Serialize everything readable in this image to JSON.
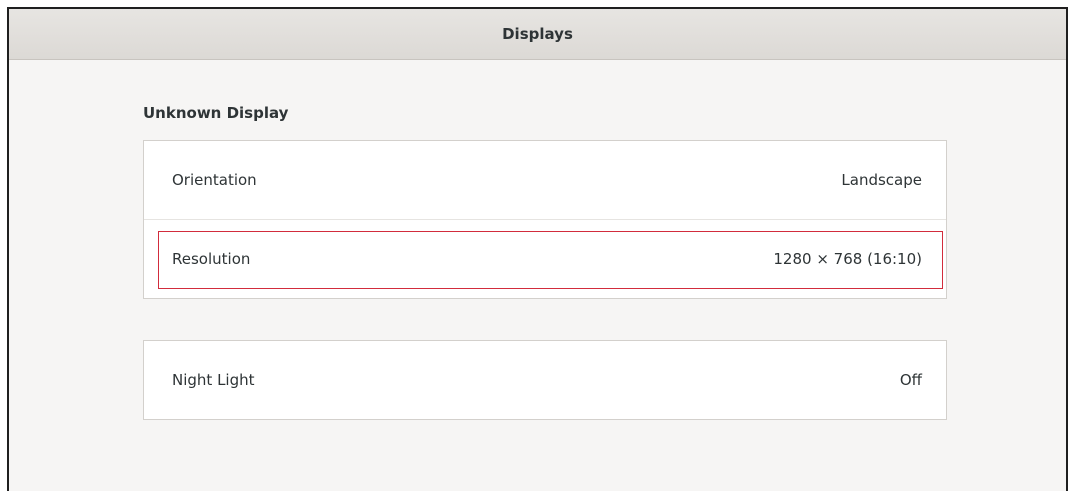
{
  "header": {
    "title": "Displays"
  },
  "display_section": {
    "title": "Unknown Display",
    "rows": [
      {
        "label": "Orientation",
        "value": "Landscape"
      },
      {
        "label": "Resolution",
        "value": "1280 × 768 (16:10)"
      }
    ]
  },
  "night_light": {
    "label": "Night Light",
    "value": "Off"
  },
  "colors": {
    "highlight": "#d22c3c",
    "background": "#f6f5f4"
  }
}
